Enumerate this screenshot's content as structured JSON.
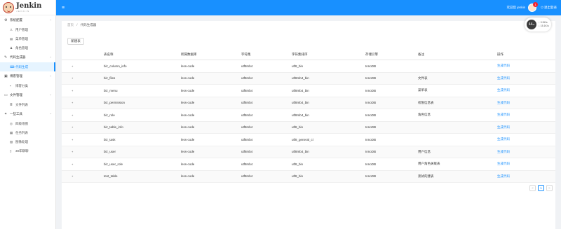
{
  "app": {
    "title": "Jenkin",
    "subtitle": "JENKIN"
  },
  "sidebar": {
    "groups": [
      {
        "label": "系统配置",
        "icon": "gear-icon",
        "items": [
          {
            "label": "用户管理",
            "icon": "user-icon"
          },
          {
            "label": "菜单管理",
            "icon": "menu-icon"
          },
          {
            "label": "角色管理",
            "icon": "role-icon"
          }
        ]
      },
      {
        "label": "代码生成器",
        "icon": "edit-icon",
        "items": [
          {
            "label": "代码生成",
            "icon": "code-icon",
            "active": true
          }
        ]
      },
      {
        "label": "博客管理",
        "icon": "book-icon",
        "items": [
          {
            "label": "博客分类",
            "icon": "tag-icon"
          }
        ]
      },
      {
        "label": "文件管理",
        "icon": "folder-icon",
        "items": [
          {
            "label": "文件列表",
            "icon": "list-icon"
          }
        ]
      },
      {
        "label": "一些工具",
        "icon": "tool-icon",
        "items": [
          {
            "label": "四级地图",
            "icon": "globe-icon"
          },
          {
            "label": "任务列表",
            "icon": "calendar-icon"
          },
          {
            "label": "图像处理",
            "icon": "image-icon"
          },
          {
            "label": "38年聊聊",
            "icon": "doc-icon"
          }
        ]
      }
    ]
  },
  "topbar": {
    "welcome": "欢迎您 jenkin",
    "badge": "1",
    "logout": "退出登录"
  },
  "breadcrumb": {
    "home": "首页",
    "sep": "/",
    "current": "代码生成器"
  },
  "stats": {
    "value": "44",
    "unit": "%",
    "line1": "↑ 0.5K/s",
    "line2": "↓ 15.1K/s"
  },
  "toolbar": {
    "new_label": "新建表"
  },
  "table": {
    "headers": [
      "",
      "表名称",
      "所属数据库",
      "字符集",
      "字符集排序",
      "存储引擎",
      "备注",
      "操作"
    ],
    "rows": [
      {
        "expand": "+",
        "name": "biz_column_info",
        "db": "less-code",
        "charset": "utf8mb4",
        "collation": "utf8_bin",
        "engine": "InnoDB",
        "comment": "",
        "action": "生成代码"
      },
      {
        "expand": "+",
        "name": "biz_files",
        "db": "less-code",
        "charset": "utf8mb4",
        "collation": "utf8mb4_bin",
        "engine": "InnoDB",
        "comment": "文件表",
        "action": "生成代码"
      },
      {
        "expand": "+",
        "name": "biz_menu",
        "db": "less-code",
        "charset": "utf8mb4",
        "collation": "utf8mb4_bin",
        "engine": "InnoDB",
        "comment": "菜单表",
        "action": "生成代码"
      },
      {
        "expand": "+",
        "name": "biz_permission",
        "db": "less-code",
        "charset": "utf8mb4",
        "collation": "utf8mb4_bin",
        "engine": "InnoDB",
        "comment": "权限信息表",
        "action": "生成代码"
      },
      {
        "expand": "+",
        "name": "biz_role",
        "db": "less-code",
        "charset": "utf8mb4",
        "collation": "utf8mb4_bin",
        "engine": "InnoDB",
        "comment": "角色信息",
        "action": "生成代码"
      },
      {
        "expand": "+",
        "name": "biz_table_info",
        "db": "less-code",
        "charset": "utf8mb4",
        "collation": "utf8_bin",
        "engine": "InnoDB",
        "comment": "",
        "action": "生成代码"
      },
      {
        "expand": "+",
        "name": "biz_task",
        "db": "less-code",
        "charset": "utf8mb4",
        "collation": "utf8_general_ci",
        "engine": "InnoDB",
        "comment": "",
        "action": "生成代码"
      },
      {
        "expand": "+",
        "name": "biz_user",
        "db": "less-code",
        "charset": "utf8mb4",
        "collation": "utf8mb4_bin",
        "engine": "InnoDB",
        "comment": "用户信息",
        "action": "生成代码"
      },
      {
        "expand": "+",
        "name": "biz_user_role",
        "db": "less-code",
        "charset": "utf8mb4",
        "collation": "utf8_bin",
        "engine": "InnoDB",
        "comment": "用户角色关联表",
        "action": "生成代码"
      },
      {
        "expand": "+",
        "name": "test_table",
        "db": "less-code",
        "charset": "utf8mb4",
        "collation": "utf8_bin",
        "engine": "InnoDB",
        "comment": "测试的建表",
        "action": "生成代码"
      }
    ]
  },
  "pagination": {
    "prev": "<",
    "page": "1",
    "next": ">"
  },
  "colors": {
    "primary": "#1890ff",
    "badge": "#f5222d"
  }
}
